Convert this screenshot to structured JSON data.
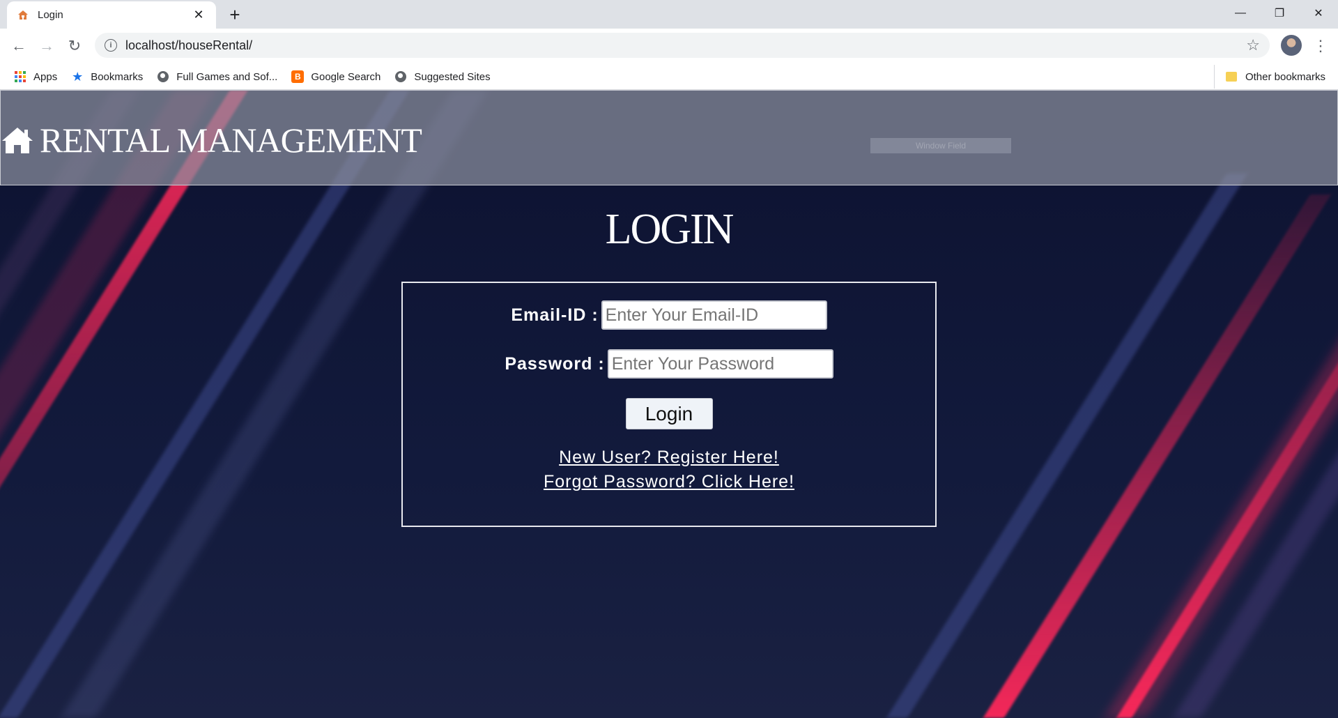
{
  "browser": {
    "tab_title": "Login",
    "url": "localhost/houseRental/",
    "bookmarks": [
      {
        "label": "Apps"
      },
      {
        "label": "Bookmarks"
      },
      {
        "label": "Full Games and Sof..."
      },
      {
        "label": "Google Search"
      },
      {
        "label": "Suggested Sites"
      }
    ],
    "other_bookmarks": "Other bookmarks"
  },
  "header": {
    "brand": "RENTAL MANAGEMENT",
    "ghost_text": "Window Field"
  },
  "login": {
    "title": "LOGIN",
    "email_label": "Email-ID :",
    "email_placeholder": "Enter Your Email-ID",
    "password_label": "Password :",
    "password_placeholder": "Enter Your Password",
    "button_label": "Login",
    "register_link": "New User? Register Here!",
    "forgot_link": "Forgot Password? Click Here!"
  },
  "colors": {
    "accent_red": "#ff1f4f",
    "stripe_blue": "#3a4a8c",
    "background": "#0e1330"
  }
}
